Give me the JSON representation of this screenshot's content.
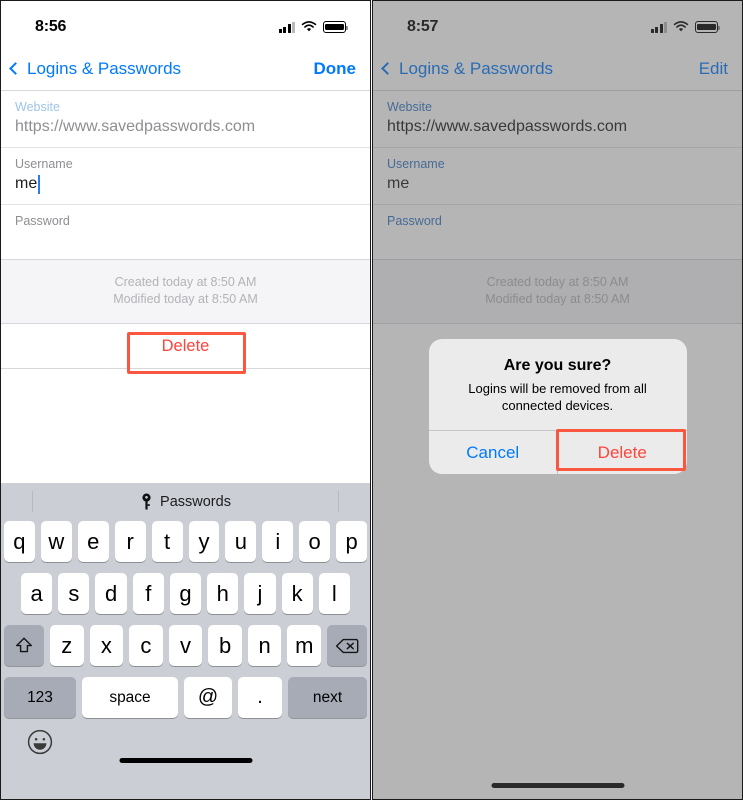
{
  "panels": [
    {
      "id": "left",
      "status": {
        "time": "8:56",
        "signal_icon": "cellular-signal-icon",
        "wifi_icon": "wifi-icon",
        "battery_icon": "battery-icon"
      },
      "nav": {
        "back_label": "Logins & Passwords",
        "back_icon": "chevron-left-icon",
        "action_label": "Done"
      },
      "fields": [
        {
          "label": "Website",
          "value": "https://www.savedpasswords.com",
          "label_style": "lightblue",
          "value_style": "muted",
          "caret": false
        },
        {
          "label": "Username",
          "value": "me",
          "label_style": "gray",
          "value_style": "normal",
          "caret": true
        },
        {
          "label": "Password",
          "value": "",
          "label_style": "gray",
          "value_style": "normal",
          "caret": false
        }
      ],
      "meta": {
        "created": "Created today at 8:50 AM",
        "modified": "Modified today at 8:50 AM"
      },
      "delete_label": "Delete",
      "keyboard": {
        "toolbar": {
          "passwords_label": "Passwords",
          "key_icon": "key-icon"
        },
        "row1": [
          "q",
          "w",
          "e",
          "r",
          "t",
          "y",
          "u",
          "i",
          "o",
          "p"
        ],
        "row2": [
          "a",
          "s",
          "d",
          "f",
          "g",
          "h",
          "j",
          "k",
          "l"
        ],
        "row3": [
          "z",
          "x",
          "c",
          "v",
          "b",
          "n",
          "m"
        ],
        "shift_icon": "shift-up-arrow-icon",
        "backspace_icon": "backspace-delete-icon",
        "numbers_label": "123",
        "space_label": "space",
        "at_label": "@",
        "dot_label": ".",
        "next_label": "next",
        "emoji_icon": "emoji-smiley-icon"
      }
    },
    {
      "id": "right",
      "status": {
        "time": "8:57",
        "signal_icon": "cellular-signal-icon",
        "wifi_icon": "wifi-icon",
        "battery_icon": "battery-icon"
      },
      "nav": {
        "back_label": "Logins & Passwords",
        "back_icon": "chevron-left-icon",
        "action_label": "Edit"
      },
      "fields": [
        {
          "label": "Website",
          "value": "https://www.savedpasswords.com",
          "label_style": "blue",
          "value_style": "normal",
          "caret": false
        },
        {
          "label": "Username",
          "value": "me",
          "label_style": "blue",
          "value_style": "normal",
          "caret": false
        },
        {
          "label": "Password",
          "value": "",
          "label_style": "blue",
          "value_style": "normal",
          "caret": false
        }
      ],
      "meta": {
        "created": "Created today at 8:50 AM",
        "modified": "Modified today at 8:50 AM"
      },
      "alert": {
        "title": "Are you sure?",
        "message": "Logins will be removed from all connected devices.",
        "cancel_label": "Cancel",
        "delete_label": "Delete"
      }
    }
  ],
  "highlights": {
    "accent_color": "#f9573f",
    "delete_button_left": "Delete",
    "delete_button_right": "Delete"
  },
  "colors": {
    "ios_blue": "#007aff",
    "destructive_red": "#ff443a",
    "label_gray": "#8e8e93",
    "keyboard_bg": "#cbced5",
    "annotation_red": "#f9573f"
  }
}
